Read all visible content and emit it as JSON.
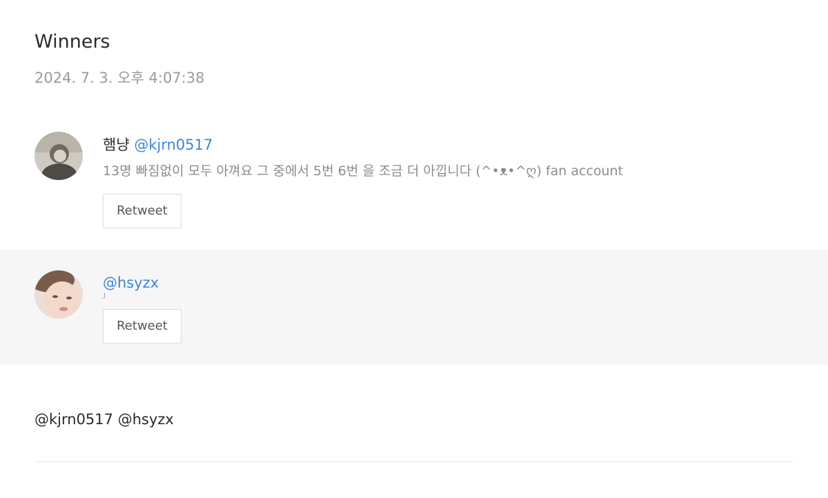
{
  "header": {
    "title": "Winners",
    "timestamp": "2024. 7. 3. 오후 4:07:38"
  },
  "entries": [
    {
      "display_name": "햄냥",
      "handle": "@kjrn0517",
      "bio": "13명 빠짐없이 모두 아껴요 그 중에서 5번 6번 을 조금 더 아낍니다 (^•ᴥ•^ღ) fan account",
      "retweet_label": "Retweet"
    },
    {
      "display_name": "",
      "handle": "@hsyzx",
      "bio": "」",
      "retweet_label": "Retweet"
    }
  ],
  "footer": {
    "mentions": "@kjrn0517 @hsyzx"
  },
  "colors": {
    "link": "#3b87d6",
    "muted_text": "#8c8c8c",
    "alt_row_bg": "#f6f6f6"
  }
}
